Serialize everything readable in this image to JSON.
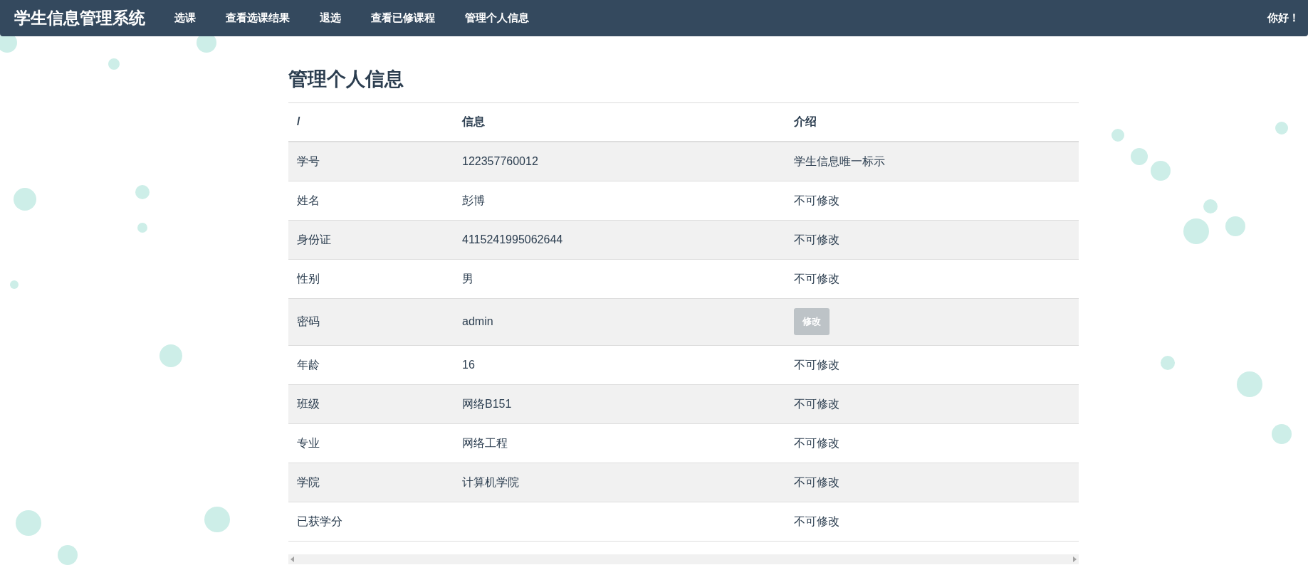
{
  "navbar": {
    "brand": "学生信息管理系统",
    "items": [
      "选课",
      "查看选课结果",
      "退选",
      "查看已修课程",
      "管理个人信息"
    ],
    "greeting": "你好！"
  },
  "page_title": "管理个人信息",
  "table": {
    "columns": [
      "/",
      "信息",
      "介绍"
    ],
    "rows": [
      {
        "field": "学号",
        "value": "122357760012",
        "note": {
          "kind": "text",
          "text": "学生信息唯一标示"
        }
      },
      {
        "field": "姓名",
        "value": "彭博",
        "note": {
          "kind": "text",
          "text": "不可修改"
        }
      },
      {
        "field": "身份证",
        "value": "4115241995062644",
        "note": {
          "kind": "text",
          "text": "不可修改"
        }
      },
      {
        "field": "性别",
        "value": "男",
        "note": {
          "kind": "text",
          "text": "不可修改"
        }
      },
      {
        "field": "密码",
        "value": "admin",
        "note": {
          "kind": "button",
          "text": "修改"
        }
      },
      {
        "field": "年龄",
        "value": "16",
        "note": {
          "kind": "text",
          "text": "不可修改"
        }
      },
      {
        "field": "班级",
        "value": "网络B151",
        "note": {
          "kind": "text",
          "text": "不可修改"
        }
      },
      {
        "field": "专业",
        "value": "网络工程",
        "note": {
          "kind": "text",
          "text": "不可修改"
        }
      },
      {
        "field": "学院",
        "value": "计算机学院",
        "note": {
          "kind": "text",
          "text": "不可修改"
        }
      },
      {
        "field": "已获学分",
        "note": {
          "kind": "text",
          "text": "不可修改"
        }
      }
    ]
  }
}
